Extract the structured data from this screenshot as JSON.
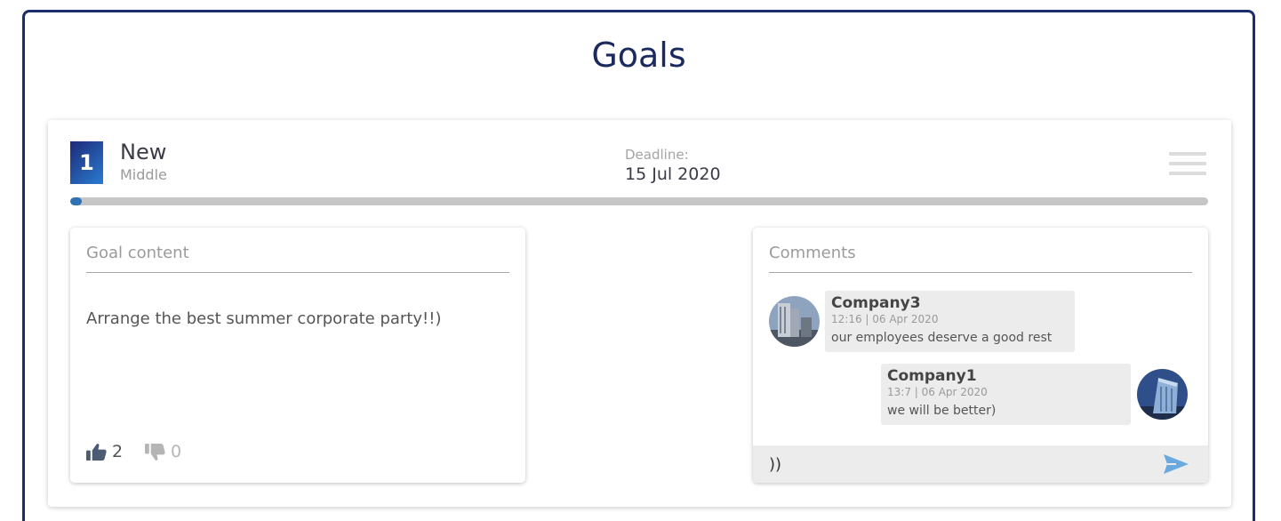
{
  "page": {
    "title": "Goals"
  },
  "goal": {
    "number": "1",
    "status": "New",
    "priority": "Middle",
    "deadline_label": "Deadline:",
    "deadline": "15 Jul 2020",
    "progress_percent": 1
  },
  "content": {
    "heading": "Goal content",
    "text": "Arrange the best summer corporate party!!)",
    "likes": "2",
    "dislikes": "0"
  },
  "comments": {
    "heading": "Comments",
    "items": [
      {
        "author": "Company3",
        "time": "12:16 | 06 Apr 2020",
        "text": "our employees deserve a good rest"
      },
      {
        "author": "Company1",
        "time": "13:7 | 06 Apr 2020",
        "text": "we will be better)"
      }
    ],
    "input_value": "))"
  },
  "colors": {
    "title": "#1a2a5e",
    "badge_start": "#1e2a78",
    "badge_end": "#2a7bd1",
    "progress_fill": "#2f72b6",
    "send_icon": "#6aa9e0"
  },
  "icons": {
    "menu": "hamburger-menu-icon",
    "like": "thumbs-up-icon",
    "dislike": "thumbs-down-icon",
    "send": "send-icon"
  }
}
